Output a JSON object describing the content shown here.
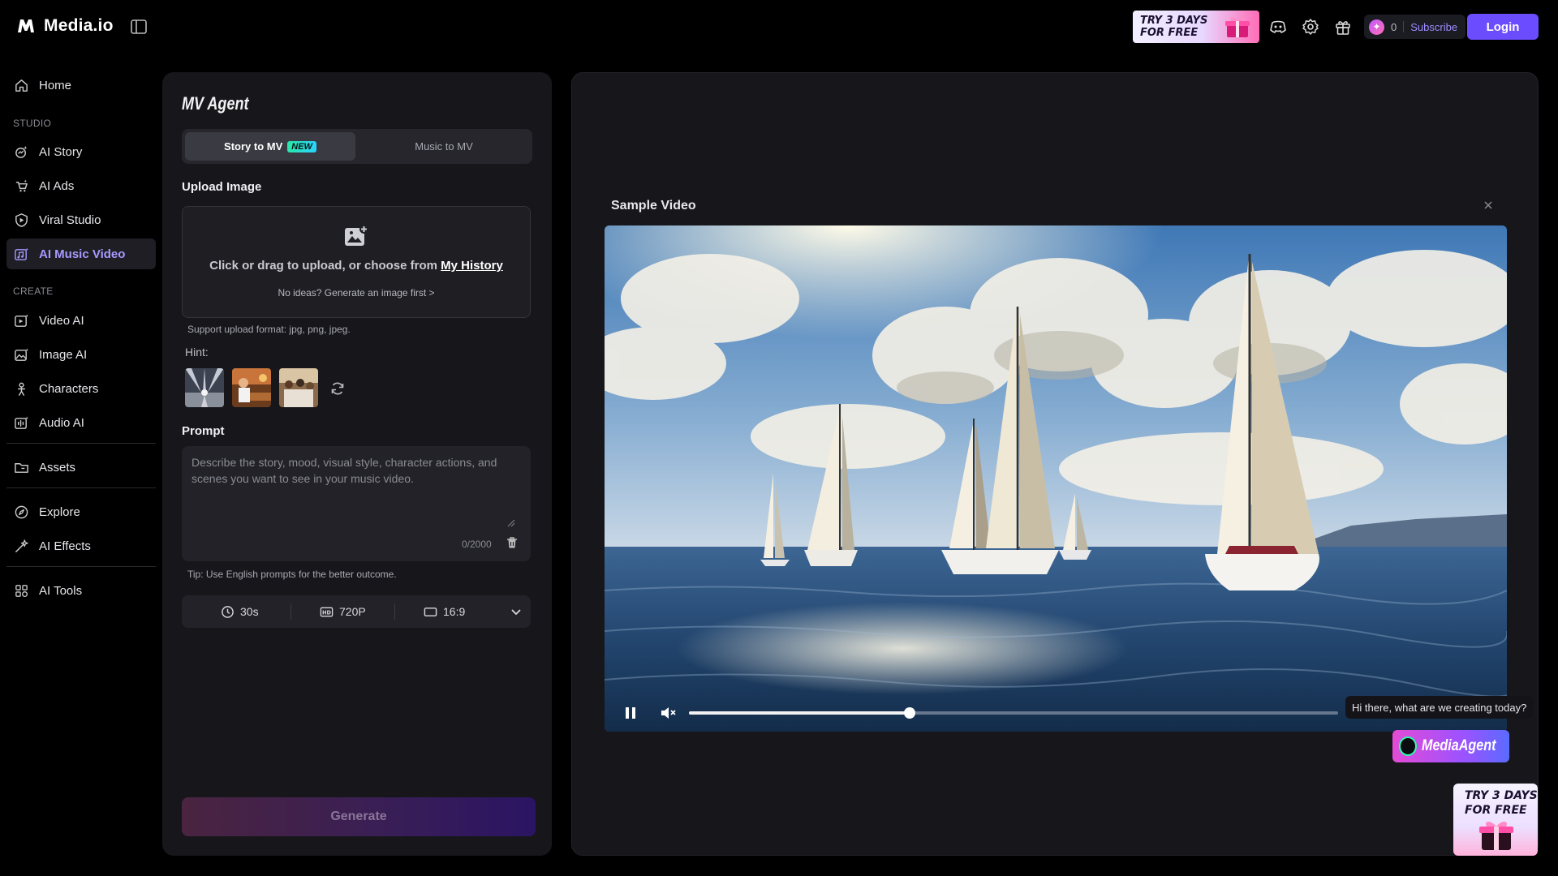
{
  "app": {
    "name": "Media.io",
    "promo_text": "TRY 3 DAYS FOR FREE",
    "promo_line1": "TRY 3 DAYS",
    "promo_line2": "FOR FREE",
    "credits": "0",
    "subscribe_label": "Subscribe",
    "login_label": "Login",
    "accent": "#6b4dff"
  },
  "sidebar": {
    "home": "Home",
    "studio_header": "STUDIO",
    "studio_items": [
      "AI Story",
      "AI Ads",
      "Viral Studio",
      "AI Music Video"
    ],
    "active_item": "AI Music Video",
    "create_header": "CREATE",
    "create_items": [
      "Video AI",
      "Image AI",
      "Characters",
      "Audio AI"
    ],
    "assets": "Assets",
    "explore_items": [
      "Explore",
      "AI Effects"
    ],
    "tools": "AI Tools"
  },
  "panel": {
    "title": "MV Agent",
    "tabs": [
      {
        "label": "Story to MV",
        "badge": "NEW",
        "selected": true
      },
      {
        "label": "Music to MV",
        "selected": false
      }
    ],
    "upload": {
      "label": "Upload Image",
      "main_text": "Click or drag to upload, or choose from",
      "link_text": "My History",
      "sub_text": "No ideas? Generate an image first >",
      "support_note": "Support upload format: jpg, png, jpeg."
    },
    "hint_label": "Hint:",
    "prompt": {
      "label": "Prompt",
      "placeholder": "Describe the story, mood, visual style, character actions, and scenes you want to see in your music video.",
      "counter": "0/2000"
    },
    "tip": "Tip: Use English prompts for the better outcome.",
    "options": {
      "duration": "30s",
      "resolution": "720P",
      "aspect": "16:9"
    },
    "generate_label": "Generate"
  },
  "preview": {
    "title": "Sample Video",
    "progress": 0.34
  },
  "agent": {
    "bubble_text": "Hi there, what are we creating today?",
    "button_label": "MediaAgent"
  }
}
